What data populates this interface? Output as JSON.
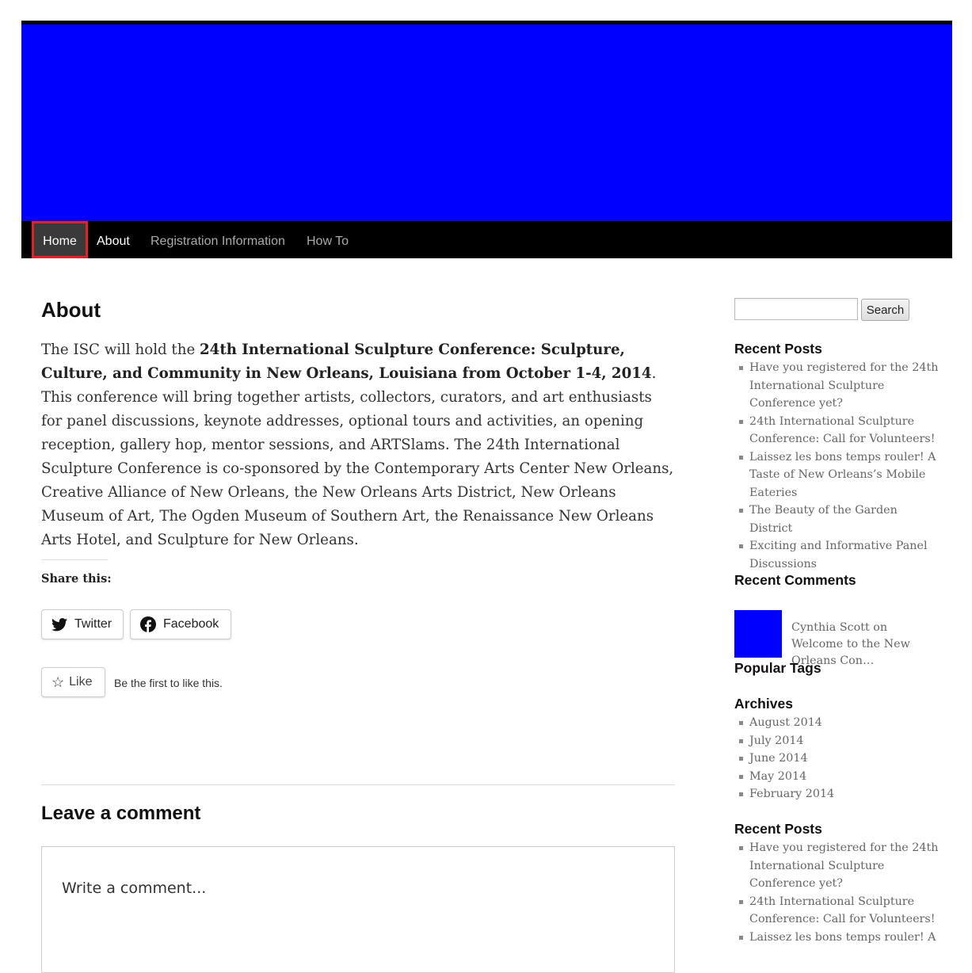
{
  "colors": {
    "banner": "#0000ff",
    "avatar": "#0000ff",
    "nav_bg": "#000000",
    "active_outline": "#e0202a"
  },
  "nav": {
    "items": [
      "Home",
      "About",
      "Registration Information",
      "How To"
    ]
  },
  "page": {
    "title": "About",
    "intro": "The ISC will hold the ",
    "bold": "24th International Sculpture Conference: Sculpture, Culture, and Community in New Orleans, Louisiana from October 1-4, 2014",
    "rest": ". This conference will bring together artists, collectors, curators, and art enthusiasts for panel discussions, keynote addresses, optional tours and activities, an opening reception, gallery hop, mentor sessions, and ARTSlams. The 24th International Sculpture Conference is co-sponsored by the Contemporary Arts Center New Orleans, Creative Alliance of New Orleans, the New Orleans Arts District, New Orleans Museum of Art, The Ogden Museum of Southern Art, the Renaissance New Orleans Arts Hotel, and Sculpture for New Orleans."
  },
  "share": {
    "title": "Share this:",
    "twitter": "Twitter",
    "facebook": "Facebook"
  },
  "like": {
    "button": "Like",
    "text": "Be the first to like this."
  },
  "comments": {
    "title": "Leave a comment",
    "placeholder": "Write a comment..."
  },
  "sidebar": {
    "search_button": "Search",
    "recent_posts_title": "Recent Posts",
    "recent_posts": [
      "Have you registered for the 24th International Sculpture Conference yet?",
      "24th International Sculpture Conference: Call for Volunteers!",
      "Laissez les bons temps rouler! A Taste of New Orleans’s Mobile Eateries",
      "The Beauty of the Garden District",
      "Exciting and Informative Panel Discussions"
    ],
    "recent_comments_title": "Recent Comments",
    "recent_comment": "Cynthia Scott on Welcome to the New Orleans Con…",
    "popular_tags_title": "Popular Tags",
    "archives_title": "Archives",
    "archives": [
      "August 2014",
      "July 2014",
      "June 2014",
      "May 2014",
      "February 2014"
    ],
    "recent_posts_title_2": "Recent Posts",
    "recent_posts_2": [
      "Have you registered for the 24th International Sculpture Conference yet?",
      "24th International Sculpture Conference: Call for Volunteers!",
      "Laissez les bons temps rouler! A"
    ]
  }
}
